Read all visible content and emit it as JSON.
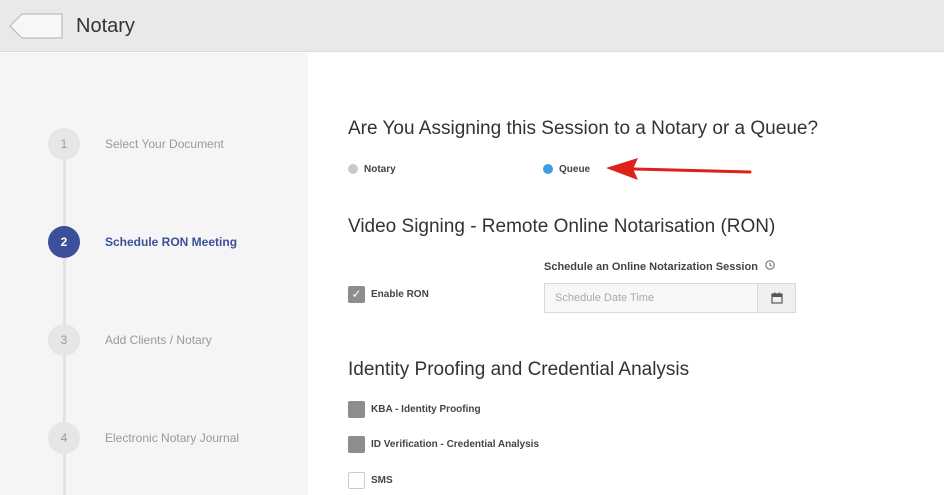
{
  "header": {
    "title": "Notary"
  },
  "steps": [
    {
      "number": "1",
      "label": "Select Your Document",
      "active": false
    },
    {
      "number": "2",
      "label": "Schedule RON Meeting",
      "active": true
    },
    {
      "number": "3",
      "label": "Add Clients / Notary",
      "active": false
    },
    {
      "number": "4",
      "label": "Electronic Notary Journal",
      "active": false
    }
  ],
  "assign": {
    "heading": "Are You Assigning this Session to a Notary or a Queue?",
    "options": [
      {
        "label": "Notary",
        "selected": false
      },
      {
        "label": "Queue",
        "selected": true
      }
    ]
  },
  "ron": {
    "heading": "Video Signing - Remote Online Notarisation (RON)",
    "enable_label": "Enable RON",
    "enabled": true,
    "schedule_label": "Schedule an Online Notarization Session",
    "schedule_placeholder": "Schedule Date Time"
  },
  "identity": {
    "heading": "Identity Proofing and Credential Analysis",
    "options": [
      {
        "label": "KBA - Identity Proofing",
        "checked": true
      },
      {
        "label": "ID Verification - Credential Analysis",
        "checked": true
      },
      {
        "label": "SMS",
        "checked": false
      }
    ]
  },
  "colors": {
    "accent": "#3c4f9a",
    "radio_selected": "#3aa0e3",
    "radio_unselected": "#c8c8c8",
    "annotation_arrow": "#e0201b"
  }
}
